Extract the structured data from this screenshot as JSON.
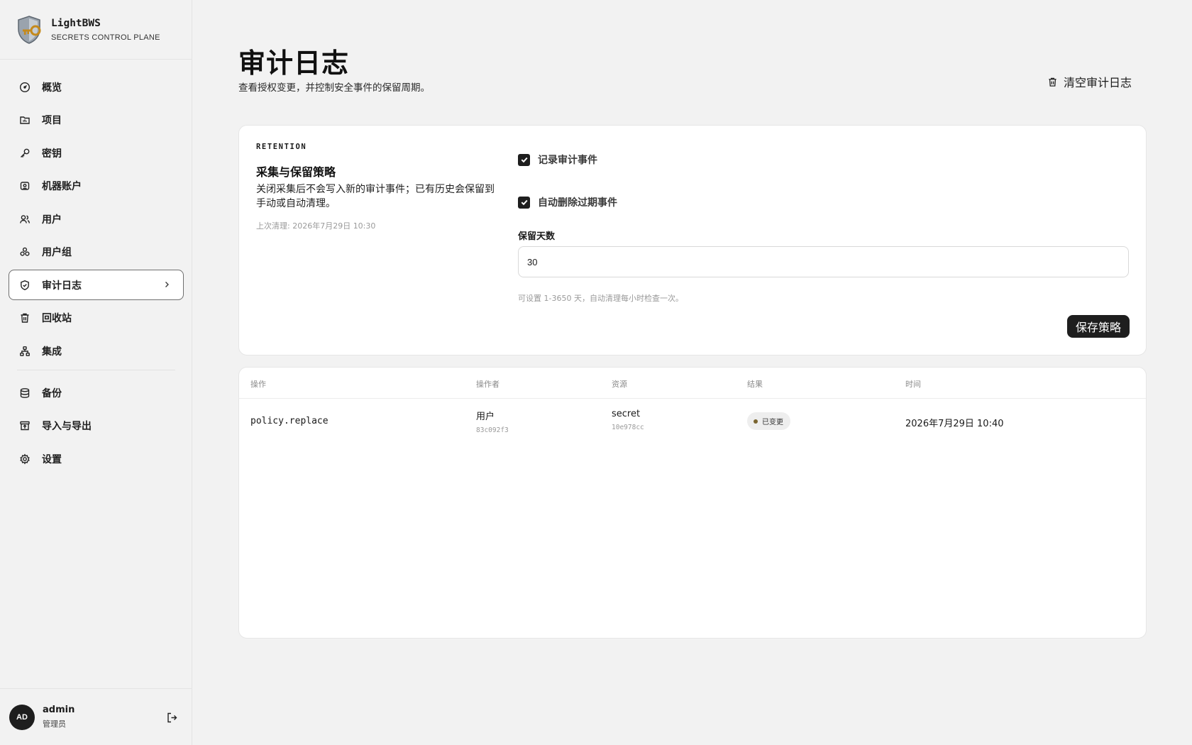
{
  "brand": {
    "name": "LightBWS",
    "subtitle": "SECRETS CONTROL PLANE"
  },
  "nav": {
    "primary": [
      {
        "label": "概览",
        "icon": "gauge-icon"
      },
      {
        "label": "项目",
        "icon": "folder-icon"
      },
      {
        "label": "密钥",
        "icon": "key-icon"
      },
      {
        "label": "机器账户",
        "icon": "machine-icon"
      },
      {
        "label": "用户",
        "icon": "users-icon"
      },
      {
        "label": "用户组",
        "icon": "group-icon"
      },
      {
        "label": "审计日志",
        "icon": "shield-check-icon",
        "active": true
      },
      {
        "label": "回收站",
        "icon": "trash-icon"
      },
      {
        "label": "集成",
        "icon": "network-icon"
      }
    ],
    "secondary": [
      {
        "label": "备份",
        "icon": "database-icon"
      },
      {
        "label": "导入与导出",
        "icon": "archive-upload-icon"
      },
      {
        "label": "设置",
        "icon": "gear-icon"
      }
    ]
  },
  "user": {
    "initials": "AD",
    "name": "admin",
    "role": "管理员"
  },
  "page": {
    "title": "审计日志",
    "subtitle": "查看授权变更，并控制安全事件的保留周期。",
    "clear_label": "清空审计日志"
  },
  "retention": {
    "tag": "RETENTION",
    "title": "采集与保留策略",
    "description": "关闭采集后不会写入新的审计事件；已有历史会保留到手动或自动清理。",
    "last_cleanup": "上次清理: 2026年7月29日 10:30",
    "record_label": "记录审计事件",
    "record_checked": true,
    "auto_delete_label": "自动删除过期事件",
    "auto_delete_checked": true,
    "days_label": "保留天数",
    "days_value": "30",
    "hint": "可设置 1-3650 天，自动清理每小时检查一次。",
    "save_label": "保存策略"
  },
  "table": {
    "headers": [
      "操作",
      "操作者",
      "资源",
      "结果",
      "时间"
    ],
    "rows": [
      {
        "action": "policy.replace",
        "actor": "用户",
        "actor_id": "83c092f3",
        "resource": "secret",
        "resource_id": "10e978cc",
        "result": "已变更",
        "time": "2026年7月29日 10:40"
      }
    ]
  }
}
